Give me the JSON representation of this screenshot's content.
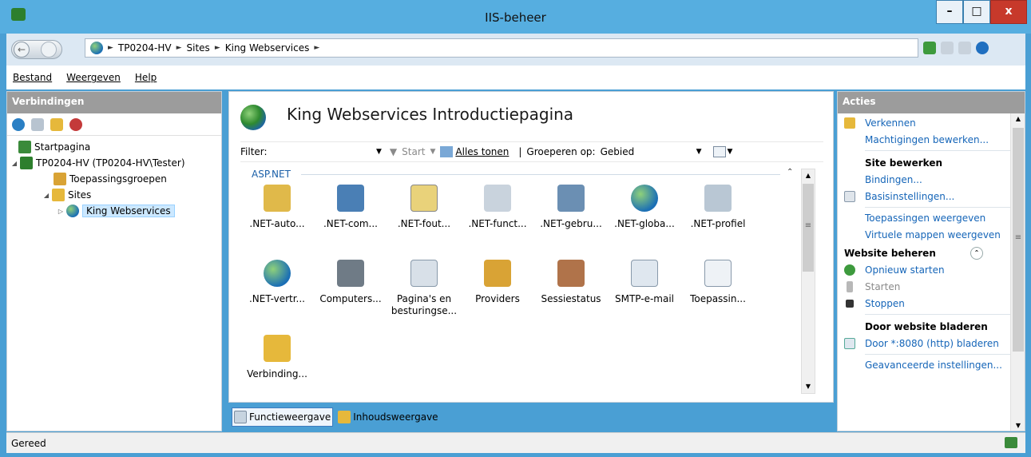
{
  "window": {
    "title": "IIS-beheer",
    "minimize": "–",
    "maximize": "□",
    "close": "x"
  },
  "address": {
    "crumbs": [
      "TP0204-HV",
      "Sites",
      "King Webservices"
    ],
    "separator": "►"
  },
  "menu": {
    "items": [
      "Bestand",
      "Weergeven",
      "Help"
    ]
  },
  "connections": {
    "header": "Verbindingen",
    "tree": {
      "start": "Startpagina",
      "server": "TP0204-HV (TP0204-HV\\Tester)",
      "apppools": "Toepassingsgroepen",
      "sites": "Sites",
      "site": "King Webservices"
    },
    "expand_open": "◢",
    "expand_closed": "▷"
  },
  "main": {
    "title": "King Webservices Introductiepagina",
    "filter_label": "Filter:",
    "dropdown_glyph": "▼",
    "start_label": "Start",
    "show_all": "Alles tonen",
    "group_by_label": "Groeperen op:",
    "group_by_value": "Gebied",
    "group_name": "ASP.NET",
    "collapse_glyph": "⌃",
    "features": [
      ".NET-auto...",
      ".NET-com...",
      ".NET-fout...",
      ".NET-funct...",
      ".NET-gebru...",
      ".NET-globa...",
      ".NET-profiel",
      ".NET-vertr...",
      "Computers...",
      "Pagina's en besturingse...",
      "Providers",
      "Sessiestatus",
      "SMTP-e-mail",
      "Toepassin...",
      "Verbinding..."
    ],
    "scroll_up": "▲",
    "scroll_down": "▼",
    "scroll_grip": "≡"
  },
  "views": {
    "features": "Functieweergave",
    "content": "Inhoudsweergave"
  },
  "actions": {
    "header": "Acties",
    "explore": "Verkennen",
    "edit_permissions": "Machtigingen bewerken...",
    "site_edit_header": "Site bewerken",
    "bindings": "Bindingen...",
    "basic_settings": "Basisinstellingen...",
    "view_apps": "Toepassingen weergeven",
    "view_vdirs": "Virtuele mappen weergeven",
    "manage_header": "Website beheren",
    "restart": "Opnieuw starten",
    "start": "Starten",
    "stop": "Stoppen",
    "browse_header": "Door website bladeren",
    "browse_port": "Door *:8080 (http) bladeren",
    "advanced": "Geavanceerde instellingen..."
  },
  "status": {
    "text": "Gereed"
  }
}
